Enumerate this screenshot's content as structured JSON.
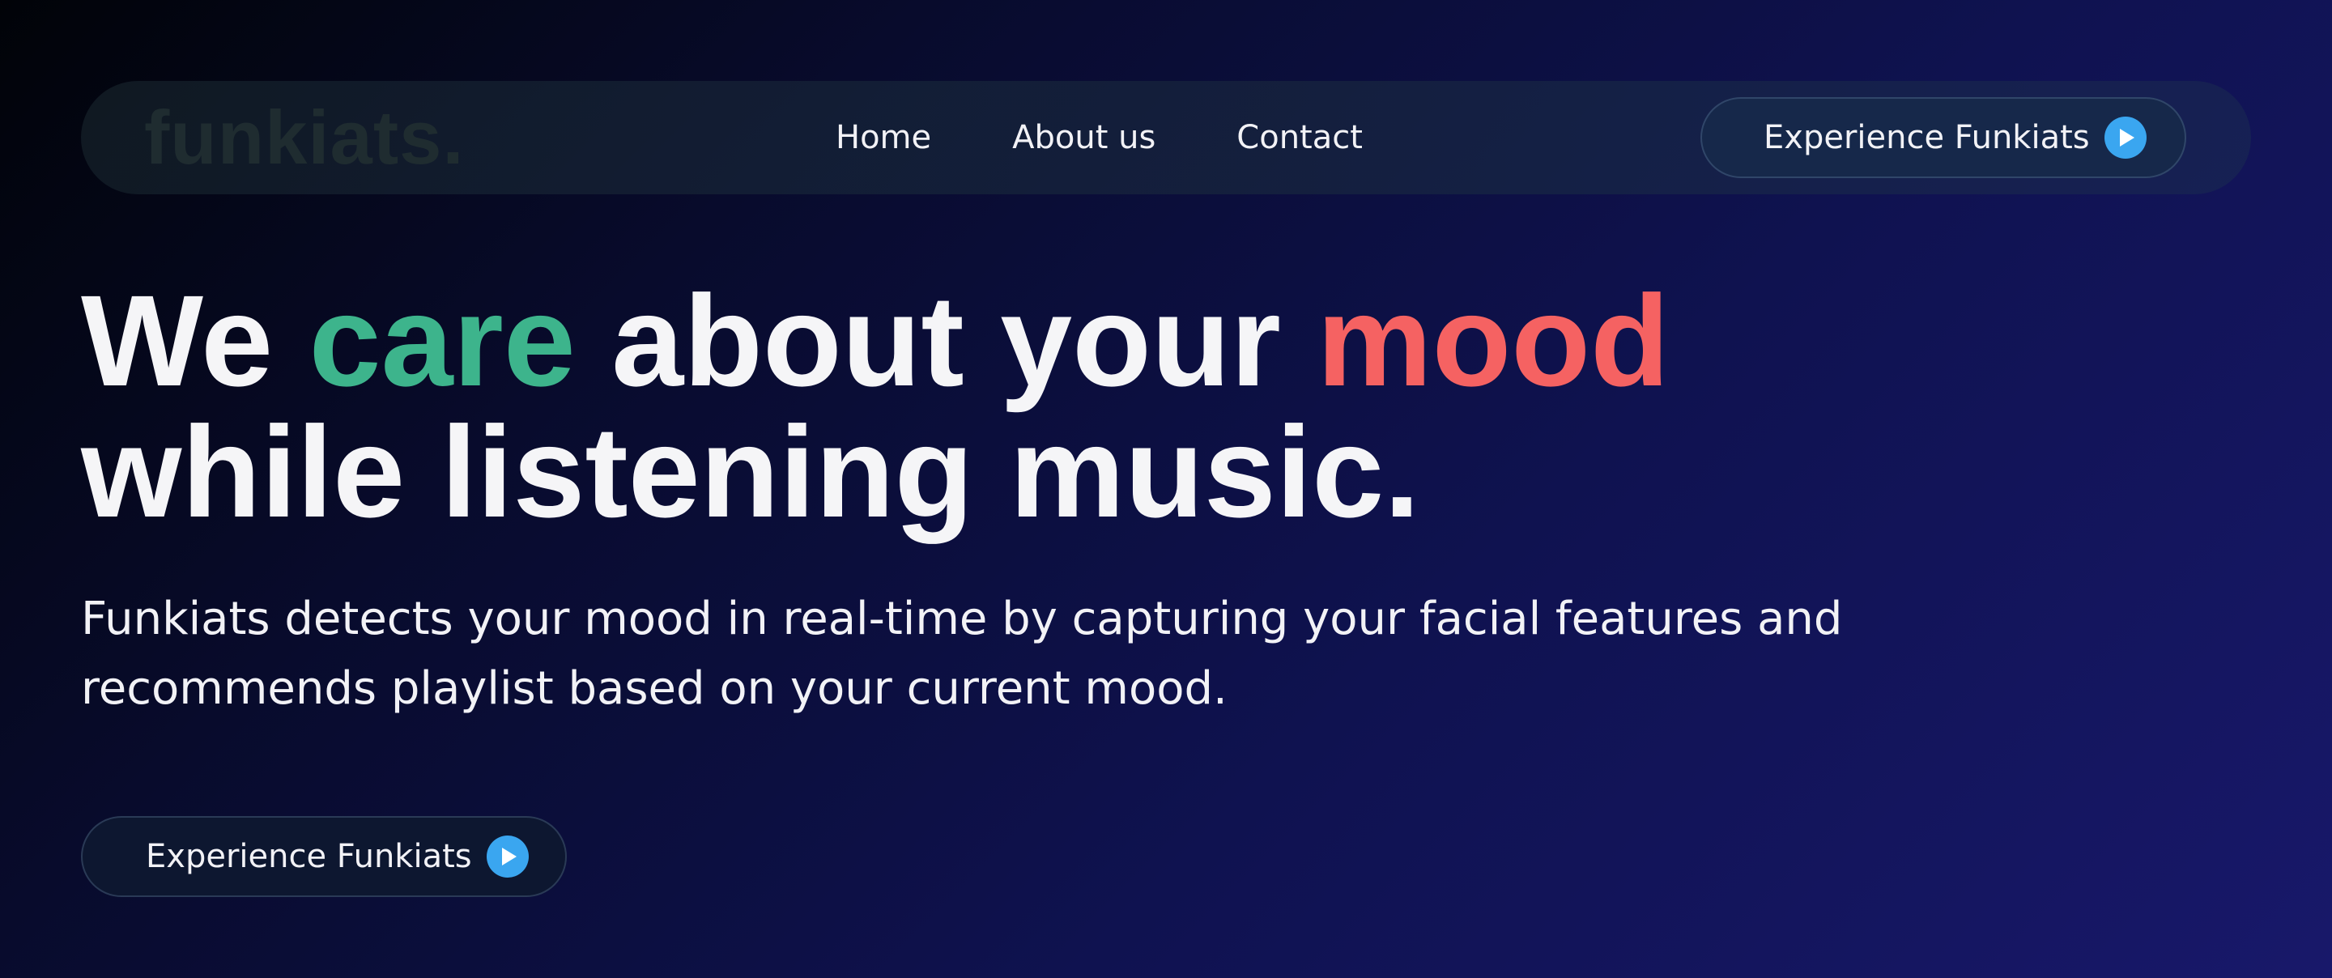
{
  "navbar": {
    "logo": "funkiats.",
    "links": [
      "Home",
      "About us",
      "Contact"
    ],
    "cta_label": "Experience Funkiats",
    "cta_icon": "play-icon"
  },
  "hero": {
    "headline": {
      "line1": {
        "we": "We",
        "care": "care",
        "about_your": "about your",
        "mood": "mood"
      },
      "line2": "while listening music."
    },
    "subtext": "Funkiats detects your mood in real-time by capturing your facial features and recommends playlist based on your current mood.",
    "cta_label": "Experience Funkiats",
    "cta_icon": "play-icon"
  },
  "colors": {
    "accent_green": "#3db48c",
    "accent_red": "#f56262",
    "play_icon": "#3aa6f0",
    "background_dark": "#010308",
    "background_indigo": "#18186a"
  }
}
